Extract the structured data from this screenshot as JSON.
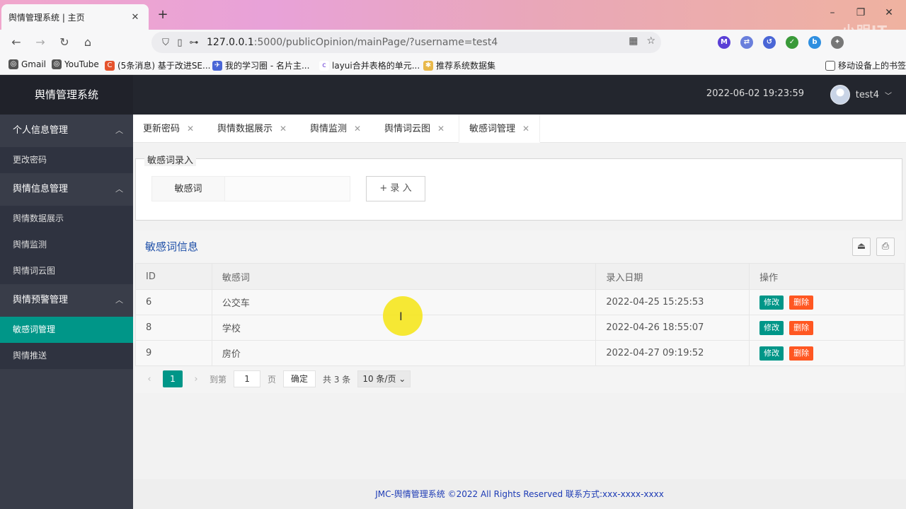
{
  "browser": {
    "tab_title": "舆情管理系统 | 主页",
    "tab_close": "✕",
    "new_tab": "+",
    "url_host": "127.0.0.1",
    "url_rest": ":5000/publicOpinion/mainPage/?username=test4",
    "watermark": "小明IT",
    "bookmarks": [
      {
        "label": "Gmail",
        "icon": "globe-icon"
      },
      {
        "label": "YouTube",
        "icon": "globe-icon"
      },
      {
        "label": "(5条消息) 基于改进SE...",
        "icon": "csdn-icon"
      },
      {
        "label": "我的学习圈 - 名片主...",
        "icon": "rocket-icon"
      },
      {
        "label": "layui合并表格的单元...",
        "icon": "c-icon"
      },
      {
        "label": "推荐系统数据集",
        "icon": "dataset-icon"
      },
      {
        "label": "移动设备上的书签",
        "icon": "mobile-icon"
      }
    ]
  },
  "app": {
    "logo": "舆情管理系统",
    "datetime": "2022-06-02 19:23:59",
    "username": "test4",
    "user_caret": "﹀"
  },
  "sidebar": {
    "groups": [
      {
        "label": "个人信息管理",
        "items": [
          "更改密码"
        ]
      },
      {
        "label": "舆情信息管理",
        "items": [
          "舆情数据展示",
          "舆情监测",
          "舆情词云图"
        ]
      },
      {
        "label": "舆情预警管理",
        "items": [
          "敏感词管理",
          "舆情推送"
        ]
      }
    ],
    "active_item": "敏感词管理"
  },
  "tabs": [
    "更新密码",
    "舆情数据展示",
    "舆情监测",
    "舆情词云图",
    "敏感词管理"
  ],
  "tab_close": "✕",
  "form": {
    "legend": "敏感词录入",
    "label": "敏感词",
    "input_value": "",
    "add_button": "+ 录 入"
  },
  "table": {
    "title": "敏感词信息",
    "columns": [
      "ID",
      "敏感词",
      "录入日期",
      "操作"
    ],
    "rows": [
      {
        "id": "6",
        "word": "公交车",
        "date": "2022-04-25 15:25:53"
      },
      {
        "id": "8",
        "word": "学校",
        "date": "2022-04-26 18:55:07"
      },
      {
        "id": "9",
        "word": "房价",
        "date": "2022-04-27 09:19:52"
      }
    ],
    "edit_label": "修改",
    "delete_label": "删除"
  },
  "pager": {
    "prev": "‹",
    "current": "1",
    "next": "›",
    "goto_label": "到第",
    "goto_value": "1",
    "page_unit": "页",
    "confirm": "确定",
    "total": "共 3 条",
    "page_size": "10 条/页 ⌄"
  },
  "footer": "JMC-舆情管理系统 ©2022 All Rights Reserved 联系方式:xxx-xxxx-xxxx"
}
